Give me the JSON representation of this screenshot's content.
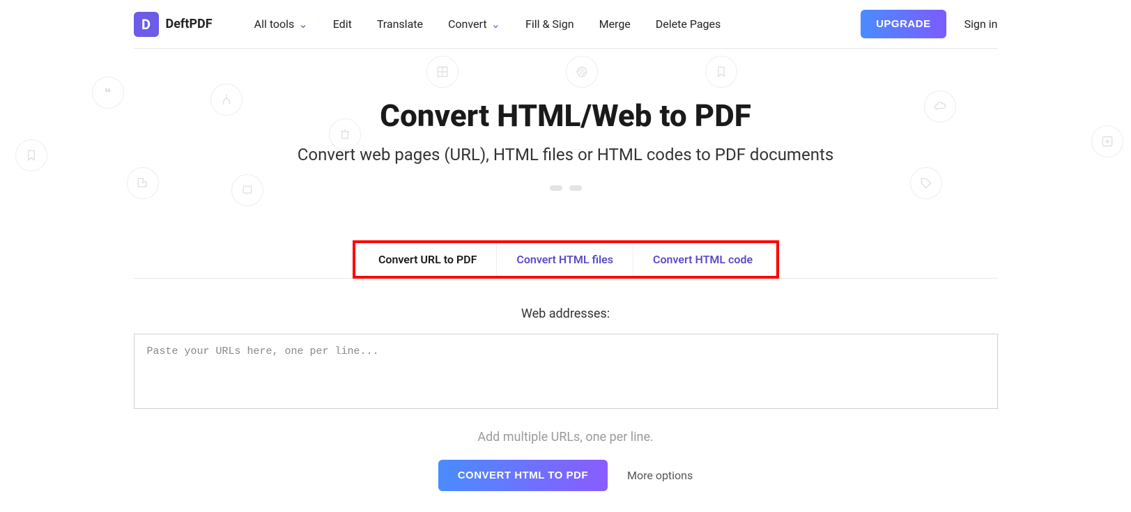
{
  "brand": {
    "initial": "D",
    "name": "DeftPDF"
  },
  "nav": {
    "all_tools": "All tools",
    "edit": "Edit",
    "translate": "Translate",
    "convert": "Convert",
    "fill_sign": "Fill & Sign",
    "merge": "Merge",
    "delete_pages": "Delete Pages"
  },
  "header_actions": {
    "upgrade": "UPGRADE",
    "signin": "Sign in"
  },
  "hero": {
    "title": "Convert HTML/Web to PDF",
    "subtitle": "Convert web pages (URL), HTML files or HTML codes to PDF documents"
  },
  "tabs": {
    "url": "Convert URL to PDF",
    "files": "Convert HTML files",
    "code": "Convert HTML code"
  },
  "form": {
    "label": "Web addresses:",
    "placeholder": "Paste your URLs here, one per line...",
    "hint": "Add multiple URLs, one per line.",
    "convert": "CONVERT HTML TO PDF",
    "more": "More options"
  }
}
